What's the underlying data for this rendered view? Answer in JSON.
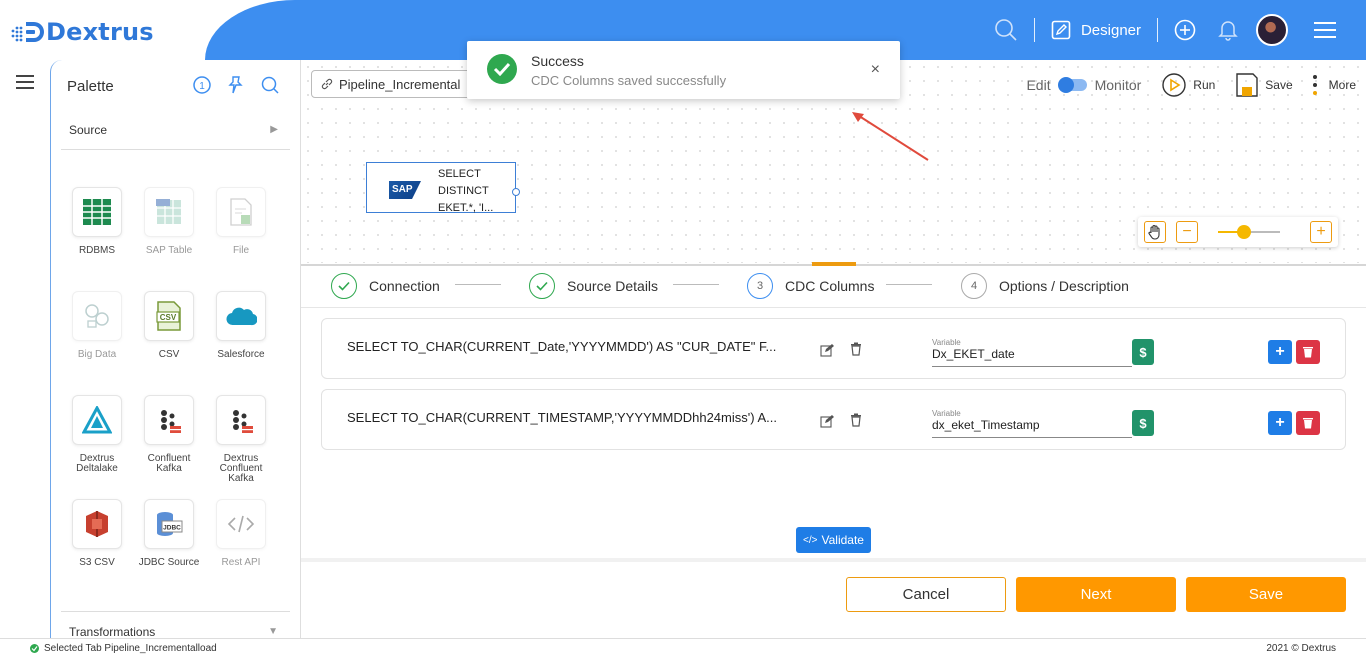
{
  "brand": {
    "name": "Dextrus",
    "color": "#2f78d8",
    "header_color": "#3d8ef0"
  },
  "header": {
    "search_icon": "search-icon",
    "designer_label": "Designer",
    "icons": [
      "search-icon",
      "designer-icon",
      "add-circle-icon",
      "bell-icon",
      "avatar",
      "menu-icon"
    ]
  },
  "palette": {
    "title": "Palette",
    "tools": [
      "info-icon",
      "pin-icon",
      "refresh-icon"
    ],
    "source_label": "Source",
    "transformations_label": "Transformations",
    "tiles": [
      {
        "label": "RDBMS",
        "icon": "table-grid-icon",
        "enabled": true
      },
      {
        "label": "SAP Table",
        "icon": "sap-table-icon",
        "enabled": false
      },
      {
        "label": "File",
        "icon": "file-icon",
        "enabled": false
      },
      {
        "label": "Big Data",
        "icon": "big-data-icon",
        "enabled": false
      },
      {
        "label": "CSV",
        "icon": "csv-icon",
        "enabled": true
      },
      {
        "label": "Salesforce",
        "icon": "cloud-icon",
        "enabled": true
      },
      {
        "label": "Dextrus Deltalake",
        "icon": "deltalake-icon",
        "enabled": true
      },
      {
        "label": "Confluent Kafka",
        "icon": "kafka-icon",
        "enabled": true
      },
      {
        "label": "Dextrus Confluent Kafka",
        "icon": "kafka-icon",
        "enabled": true
      },
      {
        "label": "S3 CSV",
        "icon": "s3-icon",
        "enabled": true
      },
      {
        "label": "JDBC Source",
        "icon": "jdbc-icon",
        "enabled": true
      },
      {
        "label": "Rest API",
        "icon": "code-icon",
        "enabled": false
      }
    ]
  },
  "pipeline": {
    "name": "Pipeline_Incremental",
    "edit_label": "Edit",
    "monitor_label": "Monitor",
    "run_label": "Run",
    "save_label": "Save",
    "more_label": "More",
    "node_text": "SELECT\nDISTINCT\nEKET.*, 'I...",
    "node_logo": "SAP",
    "zoom_level": 0.42
  },
  "toast": {
    "title": "Success",
    "message": "CDC Columns saved successfully",
    "close": "×"
  },
  "stepper": {
    "steps": [
      {
        "num": "",
        "label": "Connection",
        "state": "done"
      },
      {
        "num": "",
        "label": "Source Details",
        "state": "done"
      },
      {
        "num": "3",
        "label": "CDC Columns",
        "state": "active"
      },
      {
        "num": "4",
        "label": "Options / Description",
        "state": "pending"
      }
    ]
  },
  "cdc": {
    "variable_label": "Variable",
    "dollar_label": "$",
    "plus_label": "+",
    "rows": [
      {
        "sql": "SELECT TO_CHAR(CURRENT_Date,'YYYYMMDD') AS \"CUR_DATE\" F...",
        "variable": "Dx_EKET_date"
      },
      {
        "sql": "SELECT TO_CHAR(CURRENT_TIMESTAMP,'YYYYMMDDhh24miss') A...",
        "variable": "dx_eket_Timestamp"
      }
    ]
  },
  "actions": {
    "validate_label": "Validate",
    "cancel_label": "Cancel",
    "next_label": "Next",
    "save_label": "Save",
    "accent": "#ff9800"
  },
  "status": {
    "left": "Selected Tab Pipeline_Incrementalload",
    "right": "2021 © Dextrus"
  }
}
